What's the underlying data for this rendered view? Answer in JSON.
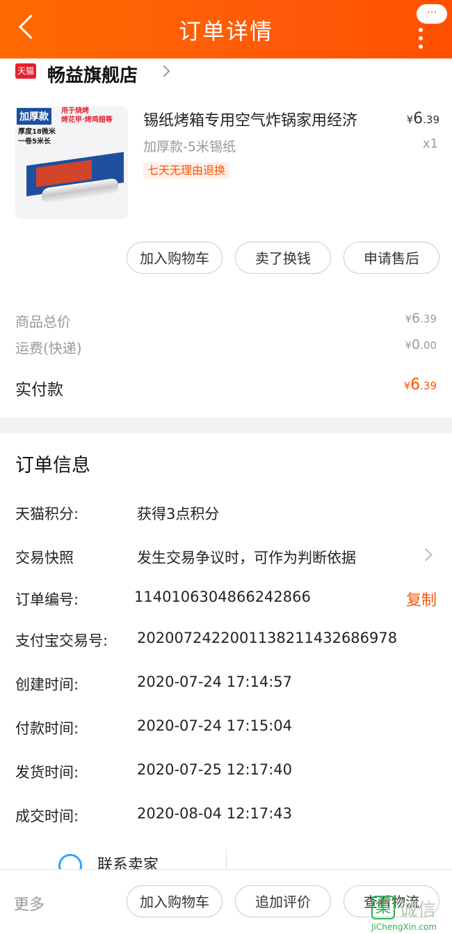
{
  "header": {
    "title": "订单详情",
    "more_dots": "···"
  },
  "shop": {
    "badge": "天猫",
    "name": "畅益旗舰店"
  },
  "product": {
    "image_tag_main": "加厚款",
    "image_tag_use": "用于烧烤\n烤花甲·烤鸡翅等",
    "image_tag_spec": "厚度18微米\n一卷5米长",
    "title": "锡纸烤箱专用空气炸锅家用经济",
    "price_symbol": "¥",
    "price_int": "6",
    "price_dec": ".39",
    "sku": "加厚款-5米锡纸",
    "qty": "x1",
    "badge": "七天无理由退换"
  },
  "item_actions": [
    "加入购物车",
    "卖了换钱",
    "申请售后"
  ],
  "summary": {
    "goods_label": "商品总价",
    "goods_int": "6",
    "goods_dec": ".39",
    "shipping_label": "运费(快递)",
    "shipping_int": "0",
    "shipping_dec": ".00",
    "paid_label": "实付款",
    "paid_int": "6",
    "paid_dec": ".39",
    "currency": "¥"
  },
  "order_info": {
    "title": "订单信息",
    "rows": [
      {
        "label": "天猫积分:",
        "value": "获得3点积分"
      },
      {
        "label": "交易快照",
        "value": "发生交易争议时，可作为判断依据"
      },
      {
        "label": "订单编号:",
        "value": "1140106304866242866"
      },
      {
        "label": "支付宝交易号:",
        "value": "2020072422001138211432686978"
      },
      {
        "label": "创建时间:",
        "value": "2020-07-24 17:14:57"
      },
      {
        "label": "付款时间:",
        "value": "2020-07-24 17:15:04"
      },
      {
        "label": "发货时间:",
        "value": "2020-07-25 12:17:40"
      },
      {
        "label": "成交时间:",
        "value": "2020-08-04 12:17:43"
      }
    ],
    "copy_label": "复制"
  },
  "contact": {
    "label": "联系卖家"
  },
  "bottom_bar": {
    "more_label": "更多",
    "buttons": [
      "加入购物车",
      "追加评价",
      "查看物流"
    ]
  },
  "watermark": {
    "glyph": "集",
    "text": "诚信",
    "url": "JiChengXin.com"
  },
  "colors": {
    "accent": "#ff5000",
    "header": "#ff6a00",
    "tmall_red": "#e8202f"
  }
}
